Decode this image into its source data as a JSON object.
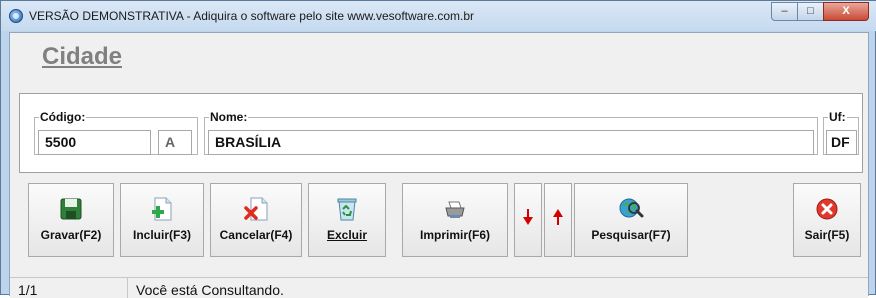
{
  "window": {
    "title": "VERSÃO DEMONSTRATIVA - Adiquira o software pelo site www.vesoftware.com.br",
    "min_glyph": "–",
    "max_glyph": "□",
    "close_glyph": "X"
  },
  "page": {
    "heading": "Cidade"
  },
  "form": {
    "codigo": {
      "label": "Código:",
      "value": "5500",
      "suffix": "A"
    },
    "nome": {
      "label": "Nome:",
      "value": "BRASÍLIA"
    },
    "uf": {
      "label": "Uf:",
      "value": "DF"
    }
  },
  "toolbar": {
    "gravar": "Gravar(F2)",
    "incluir": "Incluir(F3)",
    "cancelar": "Cancelar(F4)",
    "excluir": "Excluir",
    "imprimir": "Imprimir(F6)",
    "pesquisar": "Pesquisar(F7)",
    "sair": "Sair(F5)"
  },
  "status": {
    "record": "1/1",
    "message": "Você está Consultando."
  },
  "icons": [
    "app-icon",
    "floppy-disk-icon",
    "add-document-icon",
    "cancel-document-icon",
    "recycle-bin-icon",
    "printer-icon",
    "arrow-down-icon",
    "arrow-up-icon",
    "globe-search-icon",
    "exit-icon"
  ],
  "colors": {
    "title_bar": "#c5d9ef",
    "heading": "#808080",
    "arrow_red": "#d40000",
    "close_button": "#c94a36"
  }
}
